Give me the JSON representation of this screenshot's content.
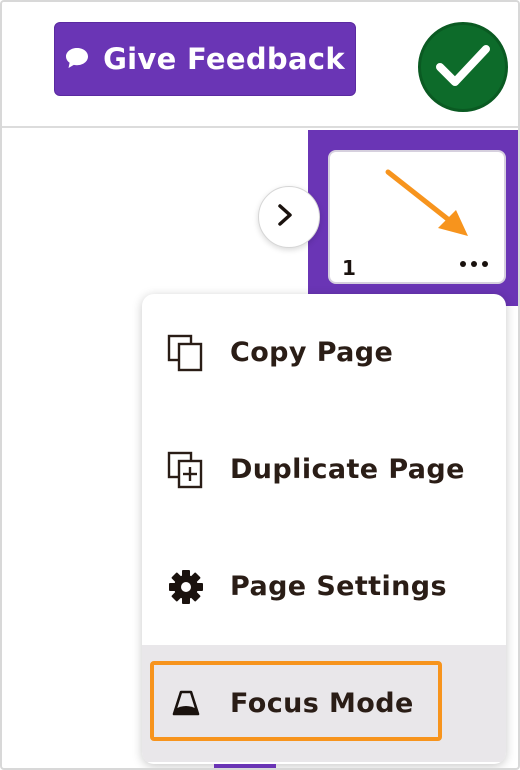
{
  "header": {
    "feedback_button": {
      "label": "Give Feedback",
      "icon": "speech-bubble-icon"
    },
    "confirm_button": {
      "icon": "checkmark-icon"
    }
  },
  "page_panel": {
    "page_number": "1",
    "more_icon": "ellipsis-icon",
    "expand_icon": "chevron-right-icon"
  },
  "context_menu": {
    "items": [
      {
        "label": "Copy Page",
        "icon": "copy-icon"
      },
      {
        "label": "Duplicate Page",
        "icon": "duplicate-icon"
      },
      {
        "label": "Page Settings",
        "icon": "gear-icon"
      },
      {
        "label": "Focus Mode",
        "icon": "focus-lamp-icon"
      }
    ]
  },
  "colors": {
    "brand_purple": "#6a35b5",
    "confirm_green": "#0d6b2a",
    "annotation_orange": "#f7941d",
    "highlight_gray": "#e9e7ea"
  }
}
